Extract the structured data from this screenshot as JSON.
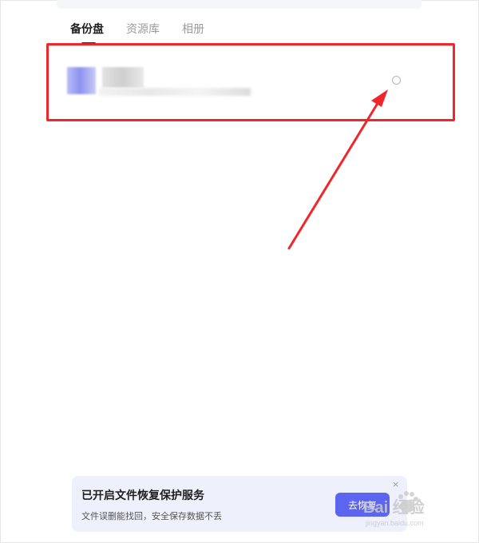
{
  "tabs": [
    {
      "label": "备份盘",
      "active": true
    },
    {
      "label": "资源库",
      "active": false
    },
    {
      "label": "相册",
      "active": false
    }
  ],
  "banner": {
    "title": "已开启文件恢复保护服务",
    "subtitle": "文件误删能找回，安全保存数据不丢",
    "button_label": "去恢复",
    "close_symbol": "×"
  },
  "watermark": {
    "logo_text": "Bai 经验",
    "sub_text": "jingyan.baidu.com"
  },
  "colors": {
    "highlight": "#f0262b",
    "accent": "#5b65f0",
    "banner_bg": "#eef0fb"
  },
  "icons": [
    "radio-circle-icon",
    "annotation-arrow-icon",
    "close-icon",
    "baidu-paw-icon"
  ]
}
